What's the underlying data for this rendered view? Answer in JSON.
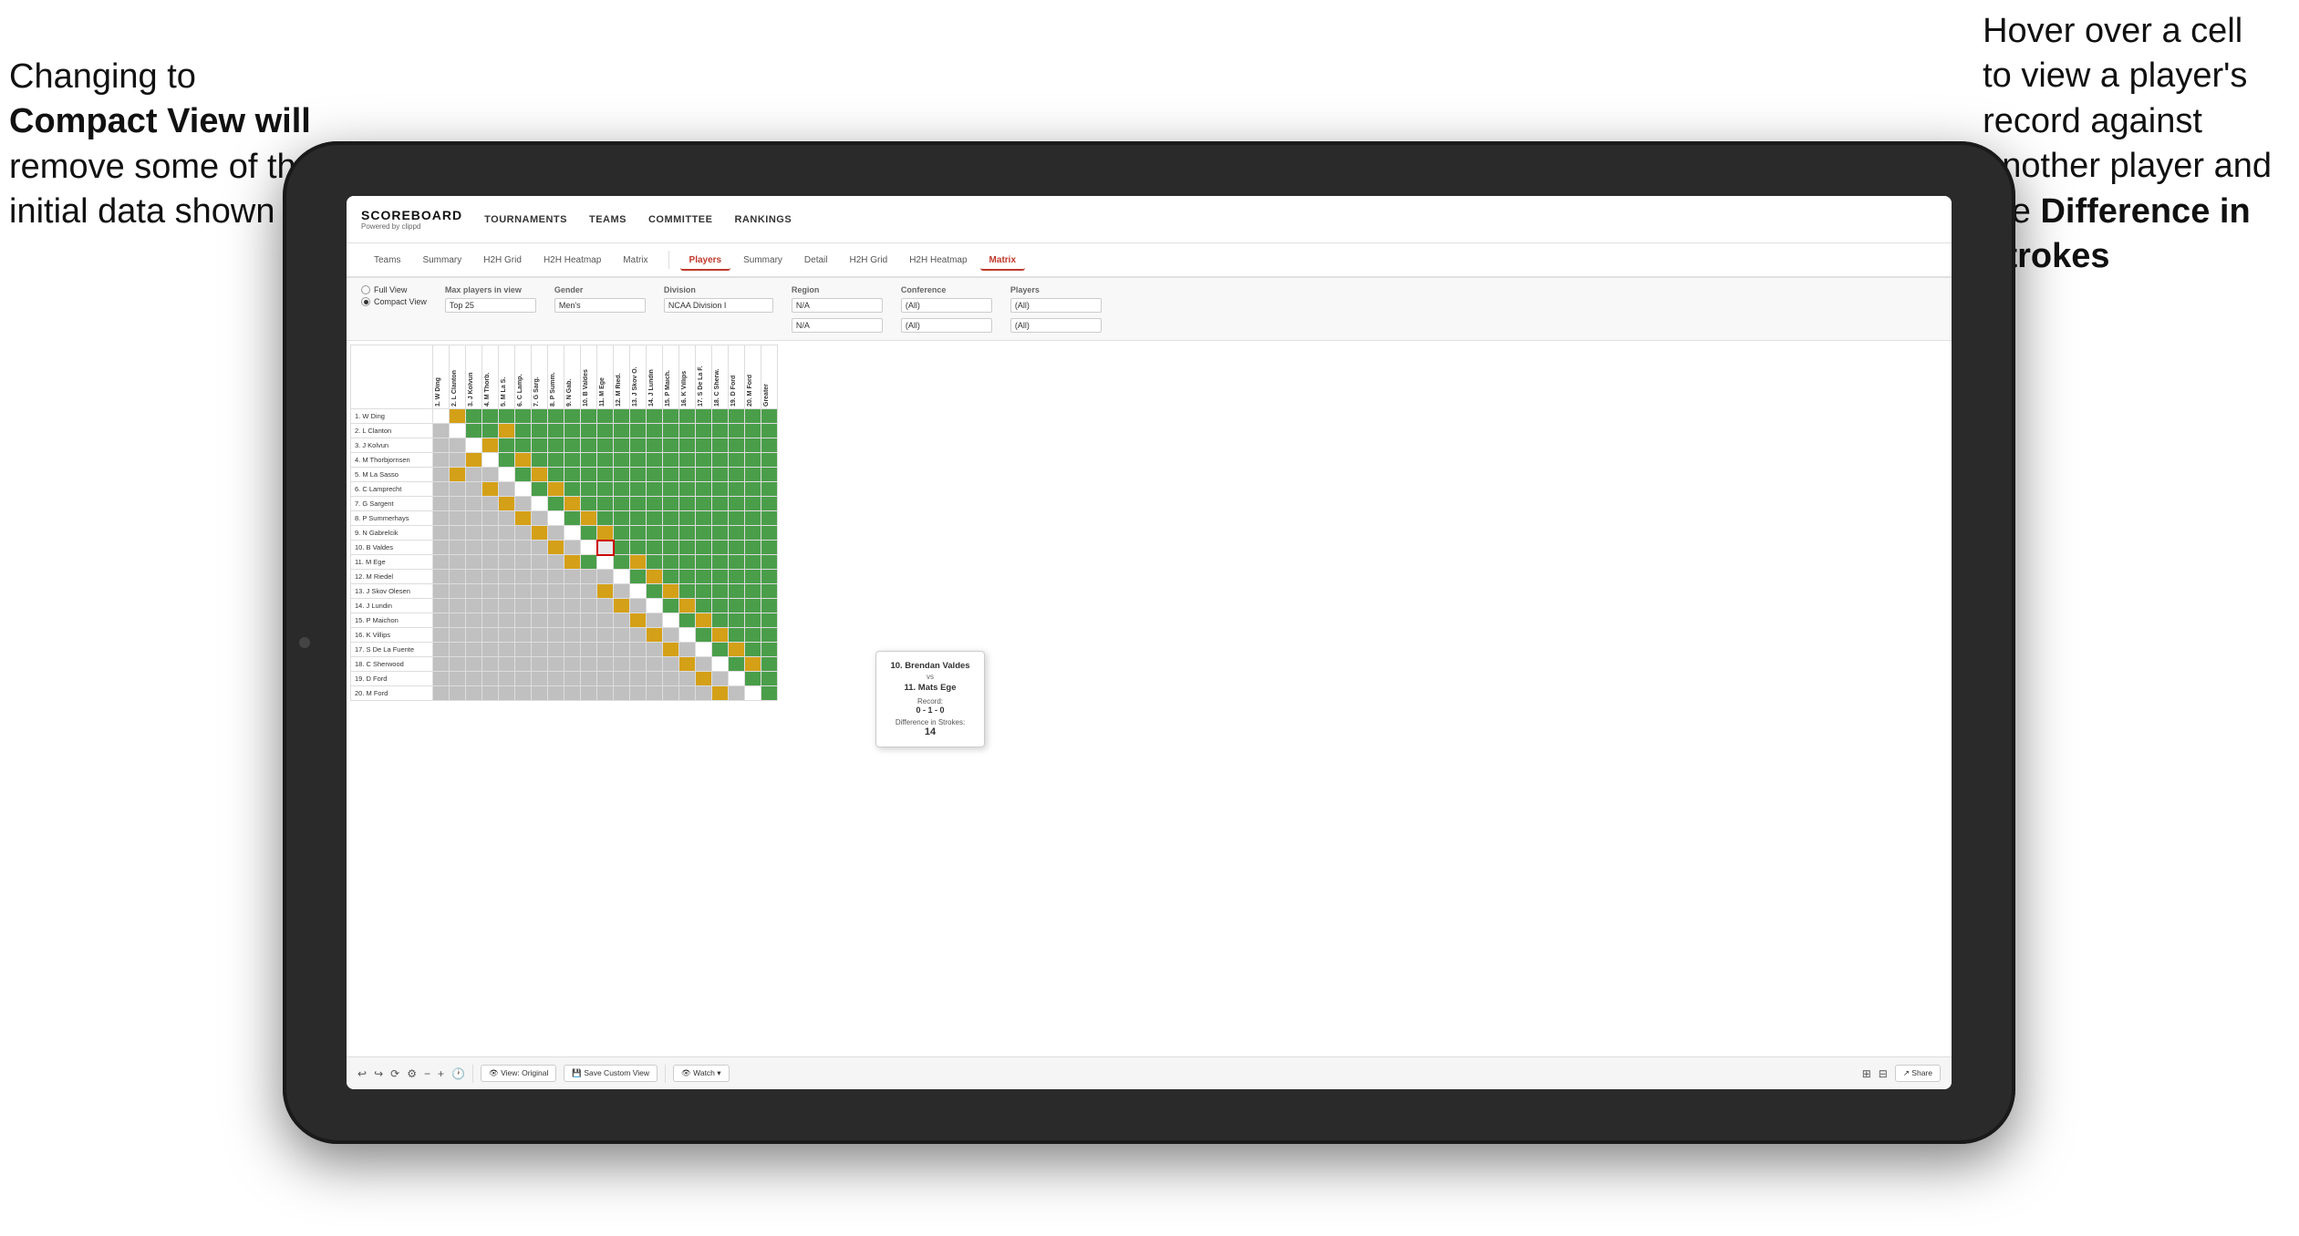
{
  "annotations": {
    "left": {
      "line1": "Changing to",
      "line2": "Compact View will",
      "line3": "remove some of the",
      "line4": "initial data shown"
    },
    "right": {
      "line1": "Hover over a cell",
      "line2": "to view a player's",
      "line3": "record against",
      "line4": "another player and",
      "line5": "the ",
      "line5bold": "Difference in",
      "line6": "Strokes"
    }
  },
  "nav": {
    "logo": "SCOREBOARD",
    "logo_sub": "Powered by clippd",
    "items": [
      "TOURNAMENTS",
      "TEAMS",
      "COMMITTEE",
      "RANKINGS"
    ]
  },
  "subtabs": {
    "group1": [
      "Teams",
      "Summary",
      "H2H Grid",
      "H2H Heatmap",
      "Matrix"
    ],
    "group2_active_label": "Players",
    "group2": [
      "Players",
      "Summary",
      "Detail",
      "H2H Grid",
      "H2H Heatmap",
      "Matrix"
    ]
  },
  "filters": {
    "view_label": "",
    "full_view": "Full View",
    "compact_view": "Compact View",
    "max_players_label": "Max players in view",
    "max_players_value": "Top 25",
    "gender_label": "Gender",
    "gender_value": "Men's",
    "division_label": "Division",
    "division_value": "NCAA Division I",
    "region_label": "Region",
    "region_value1": "N/A",
    "region_value2": "N/A",
    "conference_label": "Conference",
    "conference_value1": "(All)",
    "conference_value2": "(All)",
    "players_label": "Players",
    "players_value1": "(All)",
    "players_value2": "(All)"
  },
  "players": [
    "1. W Ding",
    "2. L Clanton",
    "3. J Kolvun",
    "4. M Thorbjornsen",
    "5. M La Sasso",
    "6. C Lamprecht",
    "7. G Sargent",
    "8. P Summerhays",
    "9. N Gabrelcik",
    "10. B Valdes",
    "11. M Ege",
    "12. M Riedel",
    "13. J Skov Olesen",
    "14. J Lundin",
    "15. P Maichon",
    "16. K Villips",
    "17. S De La Fuente",
    "18. C Sherwood",
    "19. D Ford",
    "20. M Ford"
  ],
  "col_headers": [
    "1. W Ding",
    "2. L Clanton",
    "3. J Kolvun",
    "4. M Thorb.",
    "5. M La S.",
    "6. C Lamp.",
    "7. G Sarg.",
    "8. P Summ.",
    "9. N Gab.",
    "10. B Valdes",
    "11. M Ege",
    "12. M Ried.",
    "13. J Skov O.",
    "14. J Lundin",
    "15. P Maich.",
    "16. K Villips",
    "17. S De La F.",
    "18. C Sherw.",
    "19. D Ford",
    "20. M Ford",
    "Greater"
  ],
  "tooltip": {
    "player1": "10. Brendan Valdes",
    "vs": "vs",
    "player2": "11. Mats Ege",
    "record_label": "Record:",
    "record_value": "0 - 1 - 0",
    "diff_label": "Difference in Strokes:",
    "diff_value": "14"
  },
  "toolbar": {
    "undo": "↩",
    "redo": "↪",
    "view_original": "View: Original",
    "save_custom": "Save Custom View",
    "watch": "Watch ▾",
    "share": "Share"
  }
}
